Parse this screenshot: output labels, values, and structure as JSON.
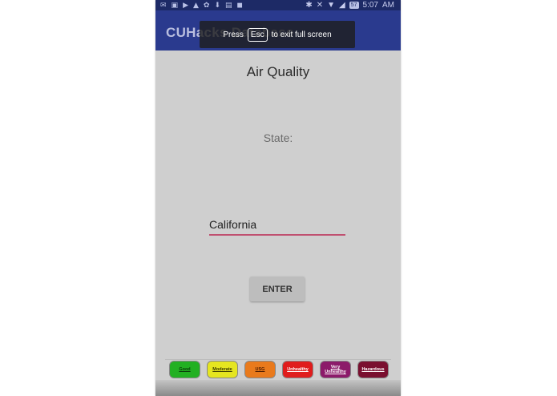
{
  "status_bar": {
    "time": "5:07",
    "battery": "57"
  },
  "app_bar": {
    "title": "CUHacks Database"
  },
  "fullscreen_notice": {
    "prefix": "Press",
    "key": "Esc",
    "suffix": "to exit full screen"
  },
  "main": {
    "title": "Air Quality",
    "state_label": "State:",
    "state_input_value": "California",
    "enter_label": "ENTER"
  },
  "legend": [
    {
      "label": "Good",
      "color": "#22b022",
      "text_color": "#0a3a0a"
    },
    {
      "label": "Moderate",
      "color": "#e5e520",
      "text_color": "#3a3a00"
    },
    {
      "label": "USG",
      "color": "#e97a1c",
      "text_color": "#4a1a00"
    },
    {
      "label": "Unhealthy",
      "color": "#e01d1d",
      "text_color": "#ffffff"
    },
    {
      "label": "Very Unhealthy",
      "color": "#8c1a6a",
      "text_color": "#ffffff"
    },
    {
      "label": "Hazardous",
      "color": "#7a1030",
      "text_color": "#ffffff"
    }
  ]
}
